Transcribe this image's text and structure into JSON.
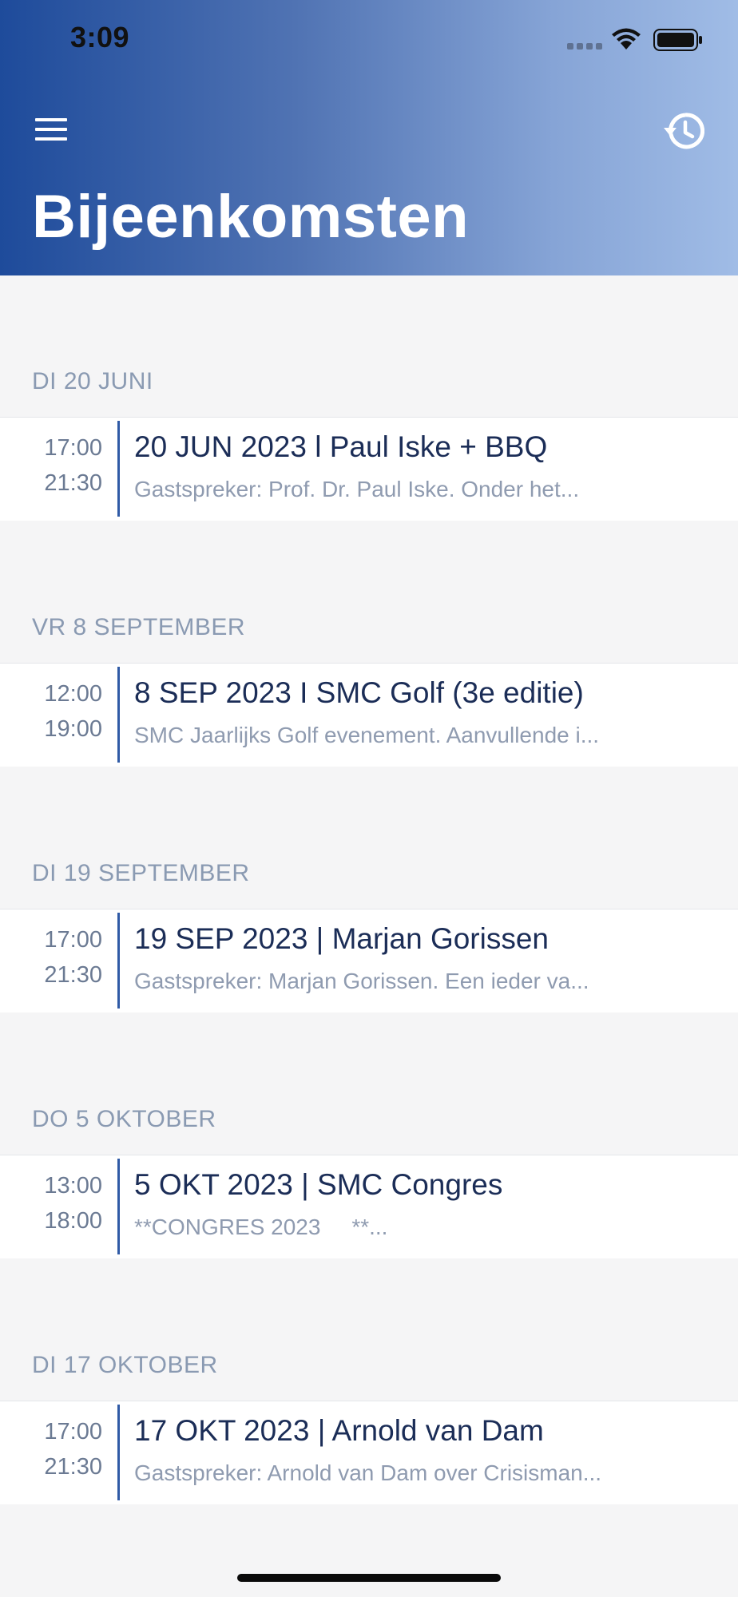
{
  "status_bar": {
    "time": "3:09"
  },
  "header": {
    "title": "Bijeenkomsten",
    "menu_icon": "menu-icon",
    "history_icon": "history-icon",
    "gradient_start": "#1e4b9b",
    "gradient_end": "#a0bce6"
  },
  "sections": [
    {
      "date_label": "DI 20 JUNI",
      "event": {
        "start": "17:00",
        "end": "21:30",
        "title": "20 JUN 2023 l Paul Iske + BBQ",
        "description": "Gastspreker: Prof. Dr. Paul Iske.  Onder het..."
      }
    },
    {
      "date_label": "VR 8 SEPTEMBER",
      "event": {
        "start": "12:00",
        "end": "19:00",
        "title": "8 SEP 2023 I SMC Golf (3e editie)",
        "description": "SMC Jaarlijks Golf evenement. Aanvullende i..."
      }
    },
    {
      "date_label": "DI 19 SEPTEMBER",
      "event": {
        "start": "17:00",
        "end": "21:30",
        "title": "19 SEP 2023 | Marjan Gorissen",
        "description": "Gastspreker: Marjan Gorissen.  Een ieder va..."
      }
    },
    {
      "date_label": "DO 5 OKTOBER",
      "event": {
        "start": "13:00",
        "end": "18:00",
        "title": "5 OKT 2023 | SMC Congres",
        "description": "**CONGRES 2023     **..."
      }
    },
    {
      "date_label": "DI 17 OKTOBER",
      "event": {
        "start": "17:00",
        "end": "21:30",
        "title": "17 OKT 2023 | Arnold van Dam",
        "description": "Gastspreker: Arnold van Dam over Crisisman..."
      }
    }
  ]
}
